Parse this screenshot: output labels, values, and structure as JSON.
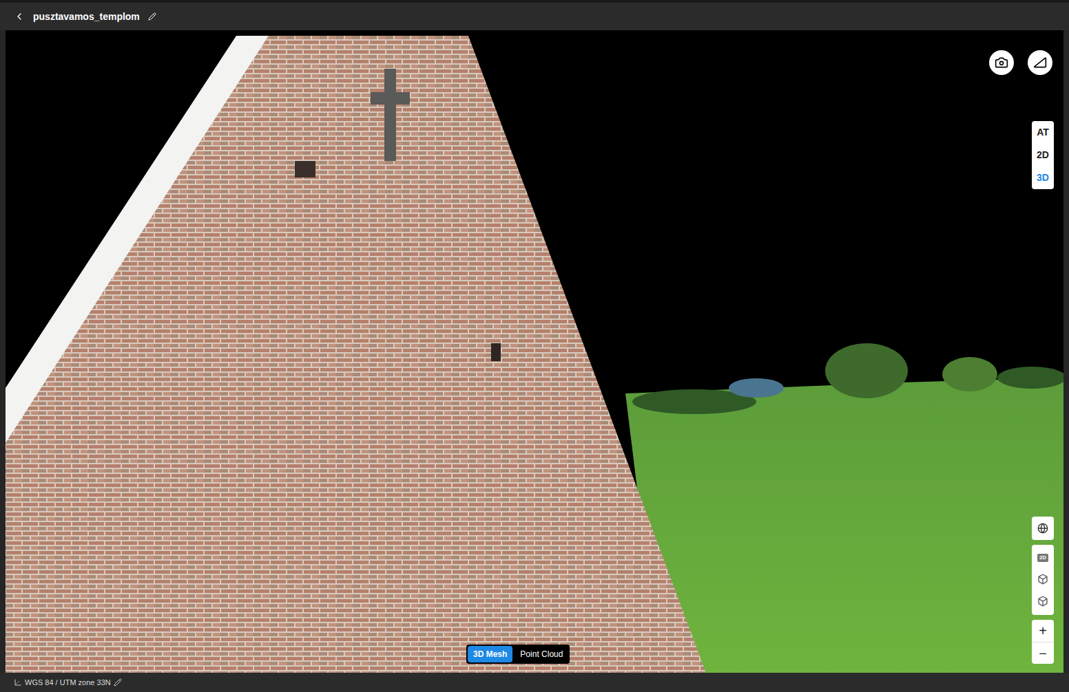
{
  "header": {
    "title": "pusztavamos_templom"
  },
  "view_modes": [
    {
      "label": "AT",
      "selected": false
    },
    {
      "label": "2D",
      "selected": false
    },
    {
      "label": "3D",
      "selected": true
    }
  ],
  "render_modes": [
    {
      "label": "3D Mesh",
      "selected": true
    },
    {
      "label": "Point Cloud",
      "selected": false
    }
  ],
  "map_tools": {
    "layer_badge": "2D",
    "zoom_in": "+",
    "zoom_out": "−"
  },
  "status_bar": {
    "crs": "WGS 84 / UTM zone 33N"
  }
}
